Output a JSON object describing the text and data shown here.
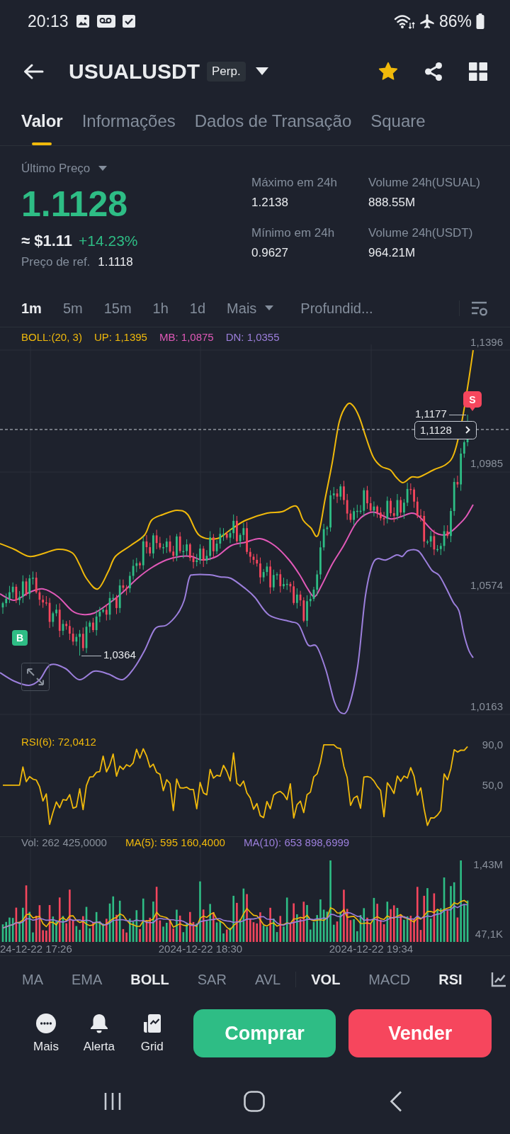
{
  "status_bar": {
    "time": "20:13",
    "battery": "86%"
  },
  "header": {
    "title": "USUALUSDT",
    "badge": "Perp.",
    "favorite": true
  },
  "tabs": [
    {
      "label": "Valor",
      "selected": true
    },
    {
      "label": "Informações",
      "selected": false
    },
    {
      "label": "Dados de Transação",
      "selected": false
    },
    {
      "label": "Square",
      "selected": false
    }
  ],
  "price": {
    "label": "Último Preço",
    "last": "1.1128",
    "approx": "≈ $1.11",
    "change": "+14.23%",
    "ref_label": "Preço de ref.",
    "ref_value": "1.1118"
  },
  "stats": [
    {
      "label": "Máximo em 24h",
      "value": "1.2138"
    },
    {
      "label": "Volume 24h(USUAL)",
      "value": "888.55M"
    },
    {
      "label": "Mínimo em 24h",
      "value": "0.9627"
    },
    {
      "label": "Volume 24h(USDT)",
      "value": "964.21M"
    }
  ],
  "timeframes": [
    {
      "label": "1m",
      "kind": "interval",
      "selected": true
    },
    {
      "label": "5m",
      "kind": "interval",
      "selected": false
    },
    {
      "label": "15m",
      "kind": "interval",
      "selected": false
    },
    {
      "label": "1h",
      "kind": "interval",
      "selected": false
    },
    {
      "label": "1d",
      "kind": "interval",
      "selected": false
    },
    {
      "label": "Mais",
      "kind": "menu",
      "selected": false
    },
    {
      "label": "Profundid...",
      "kind": "view",
      "selected": false
    }
  ],
  "main_chart": {
    "legend": [
      {
        "text": "BOLL:(20, 3)",
        "color": "#f0b90b"
      },
      {
        "text": "UP: 1,1395",
        "color": "#f0b90b"
      },
      {
        "text": "MB: 1,0875",
        "color": "#e159b8"
      },
      {
        "text": "DN: 1,0355",
        "color": "#9c7fdc"
      }
    ],
    "price_labels": [
      "1,1396",
      "1,0985",
      "1,0574",
      "1,0163"
    ],
    "high_label": "1,1177",
    "current_price": "1,1128",
    "low_label": "1,0364",
    "markers": [
      {
        "text": "B",
        "kind": "buy"
      },
      {
        "text": "S",
        "kind": "sell"
      }
    ]
  },
  "rsi": {
    "legend": "RSI(6): 72,0412",
    "labels": [
      "90,0",
      "50,0"
    ]
  },
  "volume": {
    "legend": [
      {
        "text": "Vol: 262 425,0000",
        "color": "#8a919c"
      },
      {
        "text": "MA(5): 595 160,4000",
        "color": "#f0b90b"
      },
      {
        "text": "MA(10): 653 898,6999",
        "color": "#9c7fdc"
      }
    ],
    "labels": [
      "1,43M",
      "47,1K"
    ]
  },
  "time_labels": [
    "24-12-22 17:26",
    "2024-12-22 18:30",
    "2024-12-22 19:34"
  ],
  "indicators": {
    "main": [
      {
        "label": "MA",
        "selected": false
      },
      {
        "label": "EMA",
        "selected": false
      },
      {
        "label": "BOLL",
        "selected": true
      },
      {
        "label": "SAR",
        "selected": false
      },
      {
        "label": "AVL",
        "selected": false
      }
    ],
    "sub": [
      {
        "label": "VOL",
        "selected": true
      },
      {
        "label": "MACD",
        "selected": false
      },
      {
        "label": "RSI",
        "selected": true
      }
    ]
  },
  "actions": [
    {
      "label": "Mais",
      "kind": "more"
    },
    {
      "label": "Alerta",
      "kind": "alert"
    },
    {
      "label": "Grid",
      "kind": "grid"
    }
  ],
  "trade": [
    {
      "label": "Comprar",
      "kind": "buy"
    },
    {
      "label": "Vender",
      "kind": "sell"
    }
  ]
}
